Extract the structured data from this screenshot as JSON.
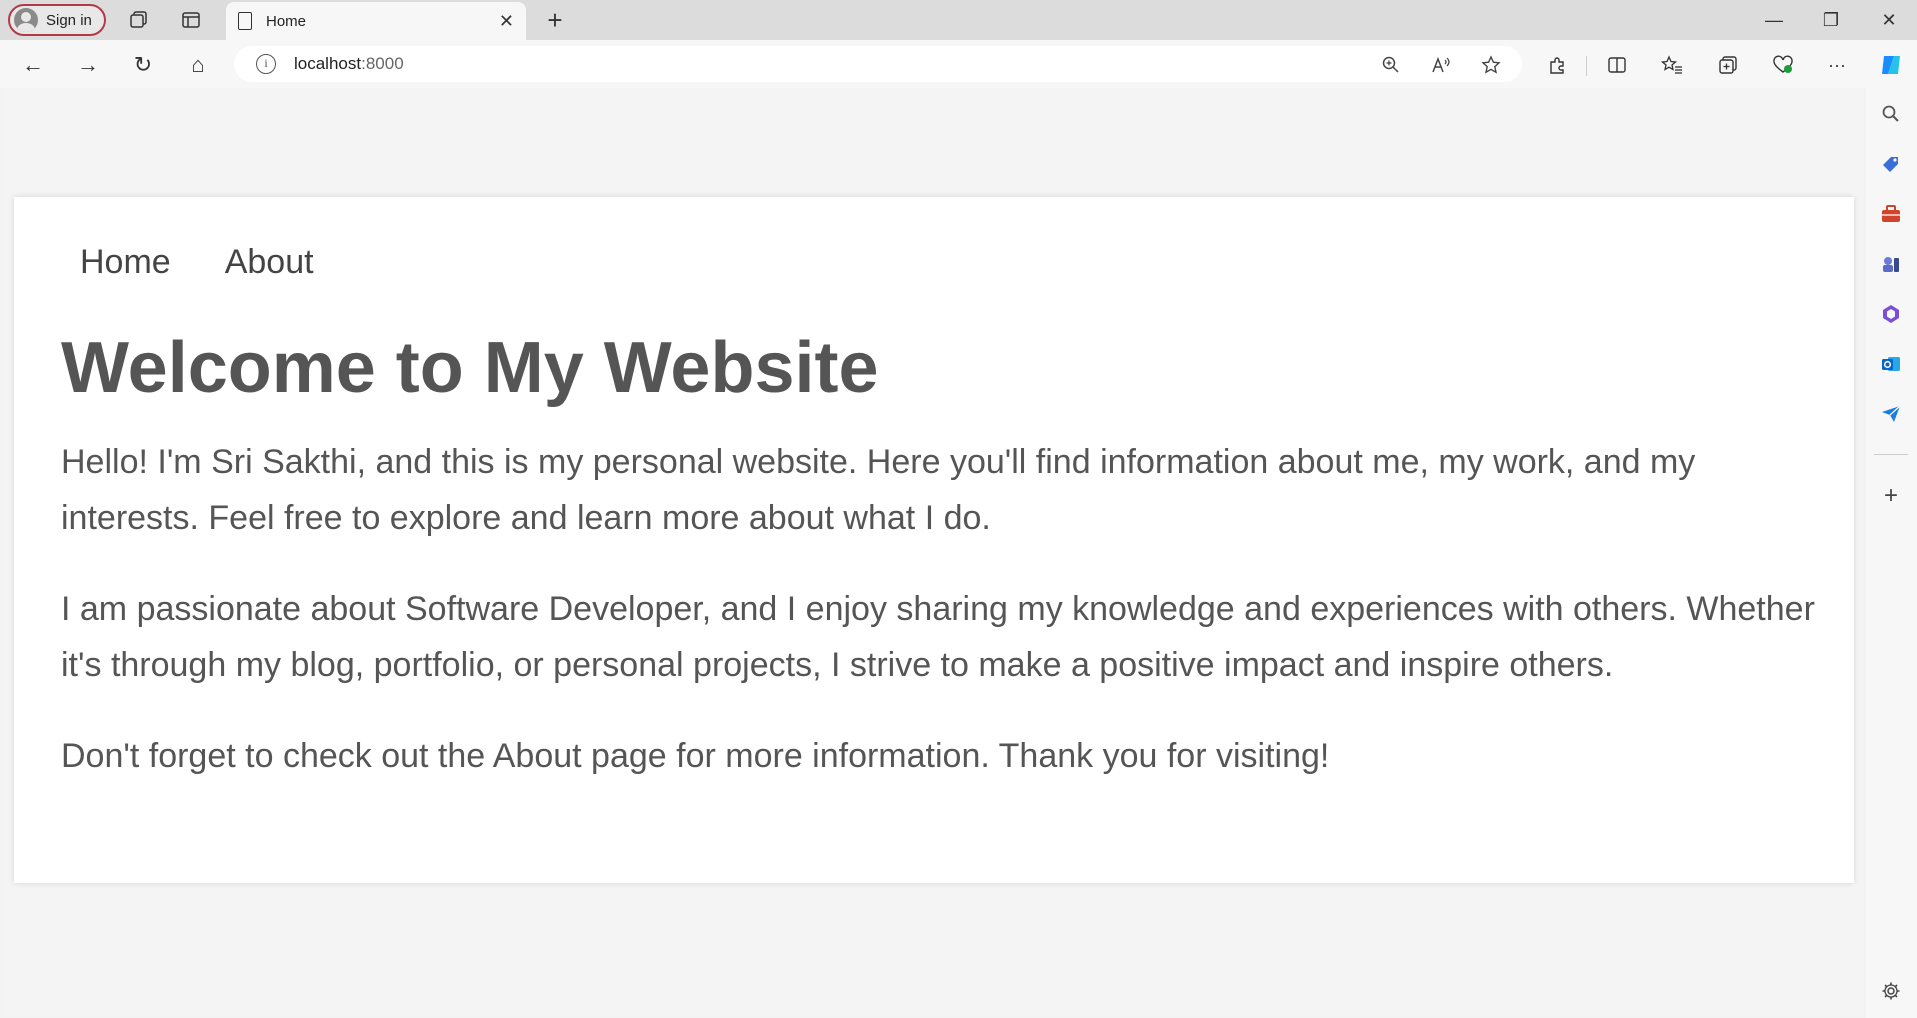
{
  "browser": {
    "signin_label": "Sign in",
    "tab_title": "Home",
    "tab_close": "✕",
    "new_tab": "+",
    "window_controls": {
      "minimize": "—",
      "restore": "❐",
      "close": "✕"
    },
    "url_host": "localhost",
    "url_port": ":8000",
    "info_glyph": "i",
    "nav_glyphs": {
      "back": "←",
      "forward": "→",
      "refresh": "↻",
      "home": "⌂"
    },
    "toolbar_glyphs": {
      "more": "···",
      "sidebar_add": "+"
    }
  },
  "page": {
    "nav": [
      {
        "label": "Home"
      },
      {
        "label": "About"
      }
    ],
    "title": "Welcome to My Website",
    "paragraphs": [
      "Hello! I'm Sri Sakthi, and this is my personal website. Here you'll find information about me, my work, and my interests. Feel free to explore and learn more about what I do.",
      "I am passionate about Software Developer, and I enjoy sharing my knowledge and experiences with others. Whether it's through my blog, portfolio, or personal projects, I strive to make a positive impact and inspire others.",
      "Don't forget to check out the About page for more information. Thank you for visiting!"
    ]
  },
  "colors": {
    "accent_signin_border": "#b23a48",
    "text": "#555555",
    "sidebar_tag": "#3b6fd8",
    "sidebar_toolbox": "#d0442b",
    "sidebar_outlook": "#0a64c8",
    "copilot": "#1a8cff"
  }
}
